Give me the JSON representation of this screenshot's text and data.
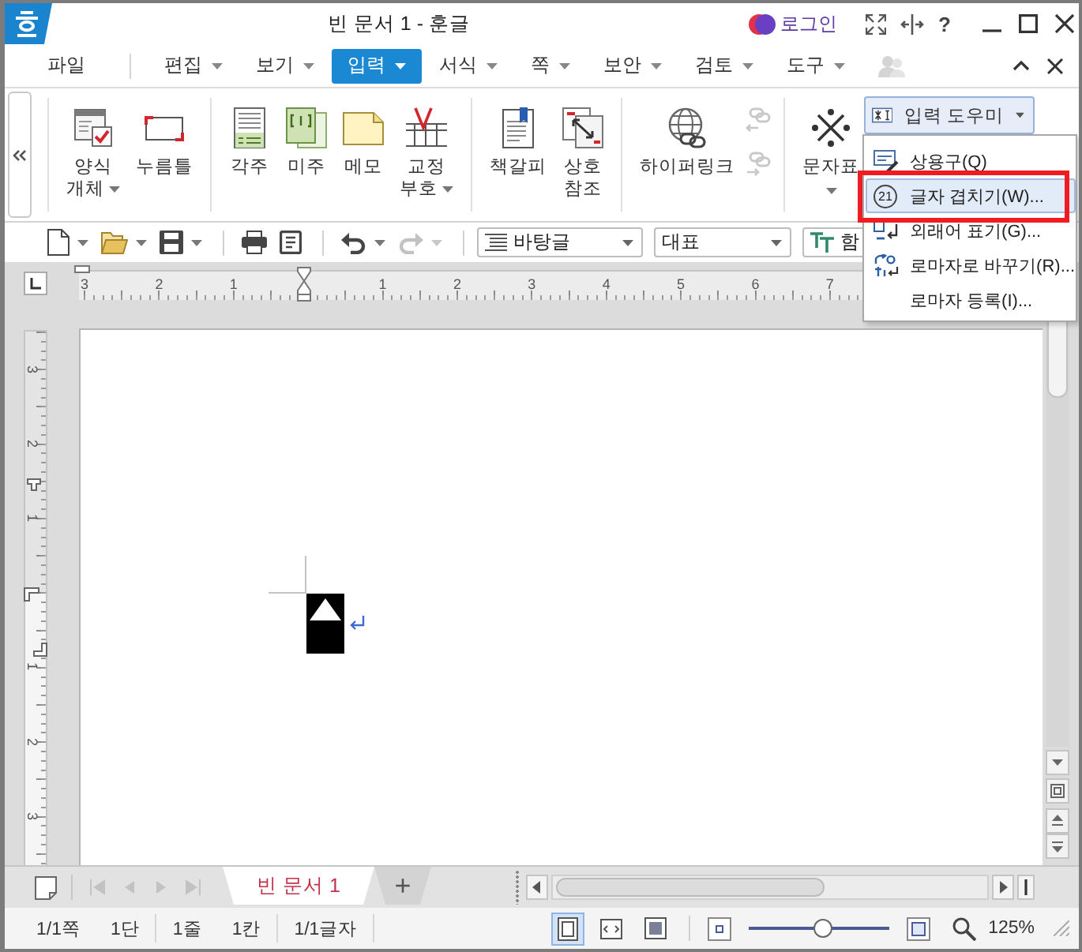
{
  "window": {
    "title": "빈 문서 1 - 훈글",
    "login": "로그인",
    "help": "?"
  },
  "menu_tabs": [
    {
      "label": "파일",
      "selected": false,
      "dropdown": false
    },
    {
      "label": "편집",
      "selected": false,
      "dropdown": true
    },
    {
      "label": "보기",
      "selected": false,
      "dropdown": true
    },
    {
      "label": "입력",
      "selected": true,
      "dropdown": true
    },
    {
      "label": "서식",
      "selected": false,
      "dropdown": true
    },
    {
      "label": "쪽",
      "selected": false,
      "dropdown": true
    },
    {
      "label": "보안",
      "selected": false,
      "dropdown": true
    },
    {
      "label": "검토",
      "selected": false,
      "dropdown": true
    },
    {
      "label": "도구",
      "selected": false,
      "dropdown": true
    }
  ],
  "ribbon": {
    "groups": [
      {
        "items": [
          {
            "lines": [
              "양식",
              "개체"
            ],
            "dropdown": true
          },
          {
            "lines": [
              "누름틀"
            ],
            "dropdown": false
          }
        ]
      },
      {
        "items": [
          {
            "lines": [
              "각주"
            ],
            "dropdown": false
          },
          {
            "lines": [
              "미주"
            ],
            "dropdown": false
          },
          {
            "lines": [
              "메모"
            ],
            "dropdown": false
          },
          {
            "lines": [
              "교정",
              "부호"
            ],
            "dropdown": true
          }
        ]
      },
      {
        "items": [
          {
            "lines": [
              "책갈피"
            ],
            "dropdown": false
          },
          {
            "lines": [
              "상호",
              "참조"
            ],
            "dropdown": false
          }
        ]
      },
      {
        "items": [
          {
            "lines": [
              "하이퍼링크"
            ],
            "dropdown": false
          }
        ],
        "side_tools": [
          {
            "disabled": true
          },
          {
            "disabled": true
          }
        ]
      },
      {
        "items": [
          {
            "lines": [
              "문자표"
            ],
            "dropdown": true
          }
        ]
      }
    ],
    "input_helper": {
      "label": "입력 도우미",
      "expanded": true
    }
  },
  "input_menu": {
    "items": [
      {
        "label": "상용구(Q)",
        "selected": false,
        "marked": false
      },
      {
        "label": "글자 겹치기(W)...",
        "selected": true,
        "marked": true,
        "icon_text": "21"
      },
      {
        "label": "외래어 표기(G)...",
        "selected": false,
        "marked": false
      },
      {
        "label": "로마자로 바꾸기(R)...",
        "selected": false,
        "marked": false
      },
      {
        "label": "로마자 등록(I)...",
        "selected": false,
        "marked": false
      }
    ]
  },
  "toolbar": {
    "button_groups": [
      [
        {
          "dropdown": true,
          "disabled": false
        },
        {
          "dropdown": true,
          "disabled": false
        },
        {
          "dropdown": true,
          "disabled": false
        }
      ],
      [
        {
          "dropdown": false,
          "disabled": false
        },
        {
          "dropdown": false,
          "disabled": false
        }
      ],
      [
        {
          "dropdown": true,
          "disabled": false
        },
        {
          "dropdown": true,
          "disabled": true
        }
      ]
    ],
    "style": "바탕글",
    "face": "대표",
    "font": "함"
  },
  "ruler": {
    "left_labels": [
      "3",
      "2",
      "1"
    ],
    "right_labels": [
      "1",
      "2",
      "3",
      "4",
      "5",
      "6",
      "7"
    ]
  },
  "vertical_ruler": {
    "top_labels": [
      "3",
      "2",
      "1"
    ],
    "bottom_labels": [
      "1",
      "2",
      "3"
    ]
  },
  "doc_tabs": {
    "nav": [
      {
        "disabled": true
      },
      {
        "disabled": true
      },
      {
        "disabled": true
      },
      {
        "disabled": true
      }
    ],
    "tabs": [
      {
        "label": "빈 문서 1",
        "selected": true
      }
    ],
    "add": "+"
  },
  "status_bar": {
    "groups": [
      [
        "1/1쪽",
        "1단"
      ],
      [
        "1줄",
        "1칸"
      ],
      [
        "1/1글자"
      ]
    ],
    "views": [
      {
        "selected": true
      },
      {
        "selected": false
      },
      {
        "selected": false
      }
    ],
    "zoom": {
      "level": 0.53,
      "reading": "125%"
    }
  }
}
